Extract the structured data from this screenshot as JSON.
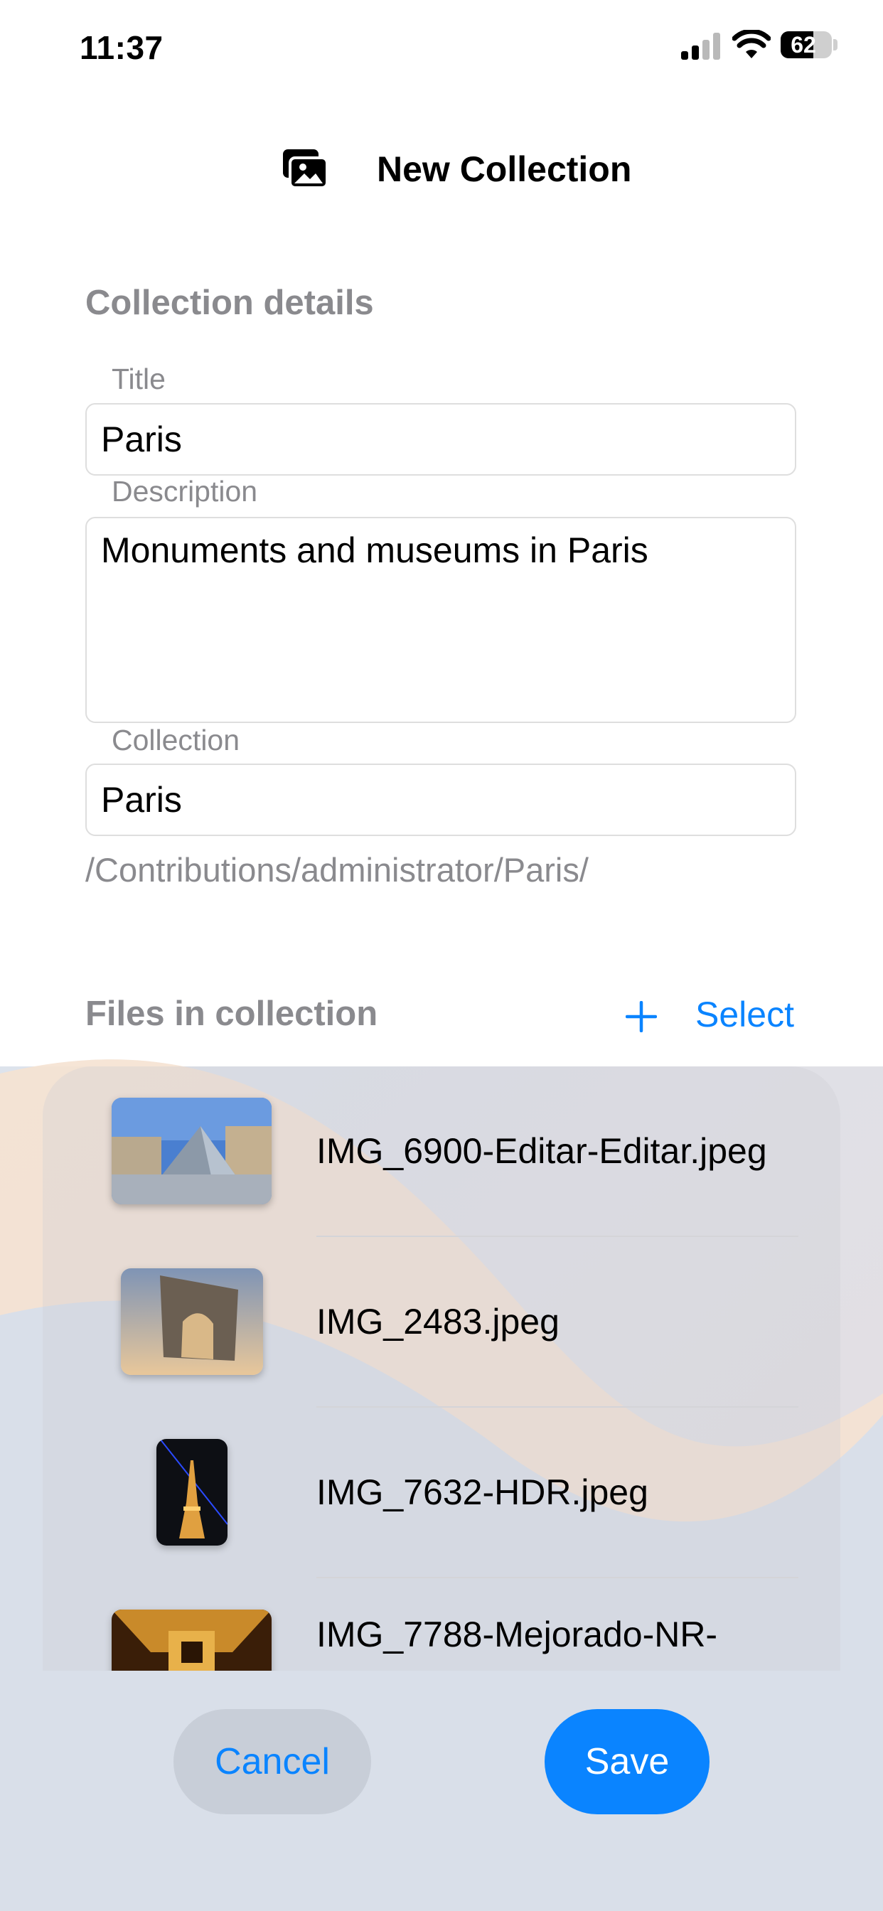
{
  "status_bar": {
    "time": "11:37",
    "battery": "62"
  },
  "header": {
    "title": "New Collection",
    "icon": "photos-stack-icon"
  },
  "details": {
    "section_title": "Collection details",
    "title_label": "Title",
    "title_value": "Paris",
    "description_label": "Description",
    "description_value": "Monuments and museums in Paris",
    "collection_label": "Collection",
    "collection_value": "Paris",
    "path": "/Contributions/administrator/Paris/"
  },
  "files": {
    "section_title": "Files in collection",
    "add_icon": "plus-icon",
    "select_label": "Select",
    "items": [
      {
        "name": "IMG_6900-Editar-Editar.jpeg"
      },
      {
        "name": "IMG_2483.jpeg"
      },
      {
        "name": "IMG_7632-HDR.jpeg"
      },
      {
        "name": "IMG_7788-Mejorado-NR-"
      }
    ]
  },
  "actions": {
    "cancel": "Cancel",
    "save": "Save"
  },
  "colors": {
    "accent": "#0a84ff",
    "secondary_text": "#8a8a8e"
  }
}
